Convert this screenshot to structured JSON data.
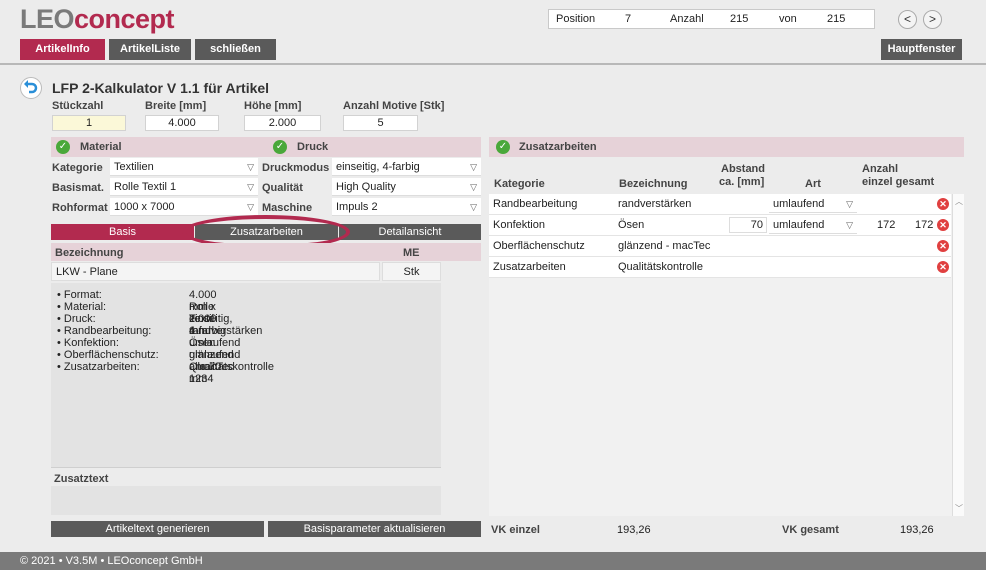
{
  "app": {
    "logo_leo": "LEO",
    "logo_concept": "concept",
    "title": "LFP 2-Kalkulator V 1.1 für Artikel"
  },
  "nav": {
    "position_label": "Position",
    "position_value": "7",
    "count_label": "Anzahl",
    "count_value": "215",
    "of_label": "von",
    "of_value": "215",
    "prev": "<",
    "next": ">"
  },
  "tabs": {
    "artikelinfo": "ArtikelInfo",
    "artikelliste": "ArtikelListe",
    "schliessen": "schließen",
    "hauptfenster": "Hauptfenster"
  },
  "params": {
    "stueckzahl_label": "Stückzahl",
    "stueckzahl_value": "1",
    "breite_label": "Breite [mm]",
    "breite_value": "4.000",
    "hoehe_label": "Höhe [mm]",
    "hoehe_value": "2.000",
    "motive_label": "Anzahl Motive [Stk]",
    "motive_value": "5"
  },
  "material": {
    "header": "Material",
    "kategorie_label": "Kategorie",
    "kategorie_value": "Textilien",
    "basismat_label": "Basismat.",
    "basismat_value": "Rolle Textil 1",
    "rohformat_label": "Rohformat",
    "rohformat_value": "1000 x 7000"
  },
  "druck": {
    "header": "Druck",
    "druckmodus_label": "Druckmodus",
    "druckmodus_value": "einseitig, 4-farbig",
    "qualitaet_label": "Qualität",
    "qualitaet_value": "High Quality",
    "maschine_label": "Maschine",
    "maschine_value": "Impuls 2"
  },
  "subtabs": {
    "basis": "Basis",
    "zusatzarbeiten": "Zusatzarbeiten",
    "detailansicht": "Detailansicht"
  },
  "basis": {
    "bezeichnung_label": "Bezeichnung",
    "me_label": "ME",
    "bezeichnung_value": "LKW - Plane",
    "me_value": "Stk",
    "details": [
      {
        "k": "• Format:",
        "v": "4.000 mm x 2.000 mm"
      },
      {
        "k": "• Material:",
        "v": "Rolle Textil 1"
      },
      {
        "k": "• Druck:",
        "v": "einseitig, 4-farbig"
      },
      {
        "k": "• Randbearbeitung:",
        "v": "randverstärken umlaufend"
      },
      {
        "k": "• Konfektion:",
        "v": "Ösen umlaufend alle 70 mm"
      },
      {
        "k": "• Oberflächenschutz:",
        "v": "glänzend - macTec 1234"
      },
      {
        "k": "• Zusatzarbeiten:",
        "v": "Qualitätskontrolle"
      }
    ],
    "zusatztext_label": "Zusatztext",
    "btn_generate": "Artikeltext generieren",
    "btn_update": "Basisparameter aktualisieren"
  },
  "zusatz": {
    "header": "Zusatzarbeiten",
    "col_kategorie": "Kategorie",
    "col_bezeichnung": "Bezeichnung",
    "col_abstand": "Abstand",
    "col_abstand2": "ca. [mm]",
    "col_art": "Art",
    "col_anzahl": "Anzahl",
    "col_einzel_gesamt": "einzel gesamt",
    "rows": [
      {
        "kategorie": "Randbearbeitung",
        "bezeichnung": "randverstärken",
        "abstand": "",
        "art": "umlaufend",
        "einzel": "",
        "gesamt": ""
      },
      {
        "kategorie": "Konfektion",
        "bezeichnung": "Ösen",
        "abstand": "70",
        "art": "umlaufend",
        "einzel": "172",
        "gesamt": "172"
      },
      {
        "kategorie": "Oberflächenschutz",
        "bezeichnung": "glänzend - macTec",
        "abstand": "",
        "art": "",
        "einzel": "",
        "gesamt": ""
      },
      {
        "kategorie": "Zusatzarbeiten",
        "bezeichnung": "Qualitätskontrolle",
        "abstand": "",
        "art": "",
        "einzel": "",
        "gesamt": ""
      }
    ],
    "vk_einzel_label": "VK einzel",
    "vk_einzel_value": "193,26",
    "vk_gesamt_label": "VK gesamt",
    "vk_gesamt_value": "193,26"
  },
  "footer": "© 2021 • V3.5M • LEOconcept GmbH",
  "colors": {
    "accent": "#b22a4f",
    "tab_gray": "#5a5a5a",
    "pink": "#e6d2d8"
  }
}
